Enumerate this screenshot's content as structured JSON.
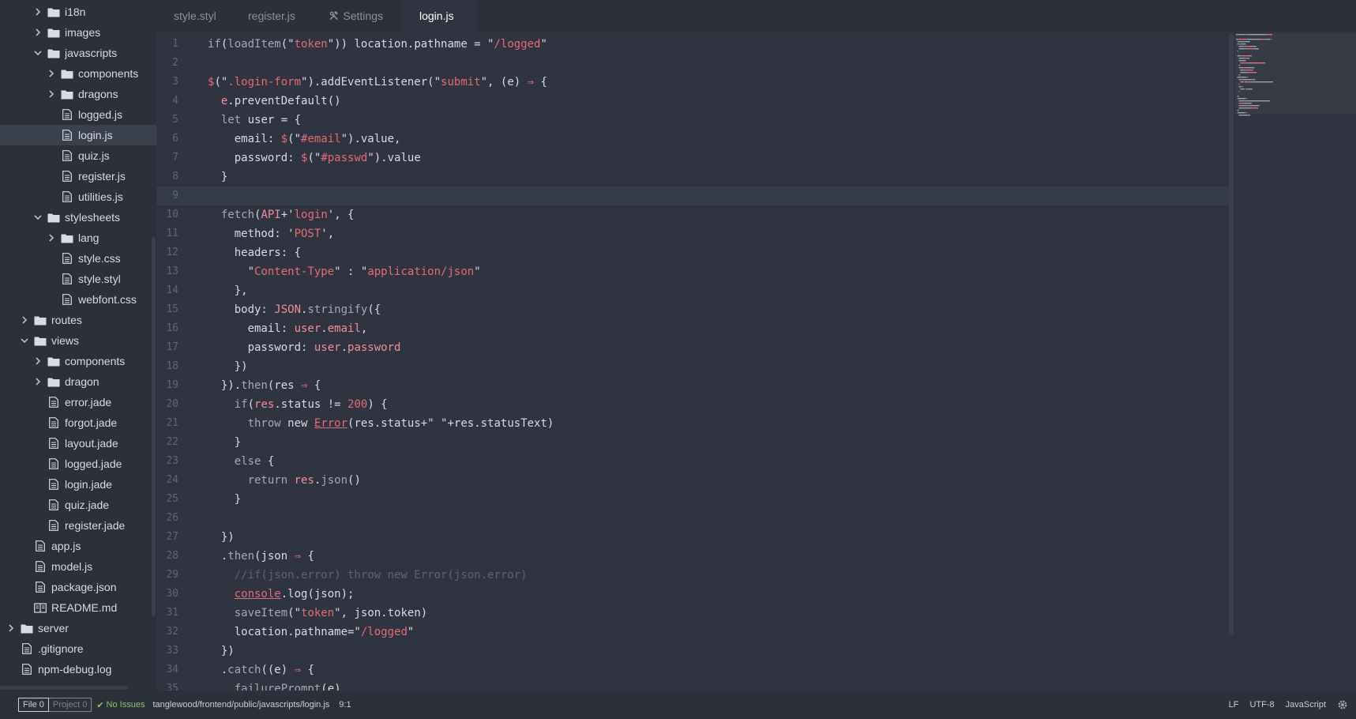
{
  "sidebar": {
    "items": [
      {
        "label": "i18n",
        "type": "folder",
        "collapsed": true,
        "depth": 3
      },
      {
        "label": "images",
        "type": "folder",
        "collapsed": true,
        "depth": 3
      },
      {
        "label": "javascripts",
        "type": "folder",
        "collapsed": false,
        "depth": 3
      },
      {
        "label": "components",
        "type": "folder",
        "collapsed": true,
        "depth": 4
      },
      {
        "label": "dragons",
        "type": "folder",
        "collapsed": true,
        "depth": 4
      },
      {
        "label": "logged.js",
        "type": "file",
        "depth": 4
      },
      {
        "label": "login.js",
        "type": "file",
        "depth": 4,
        "selected": true
      },
      {
        "label": "quiz.js",
        "type": "file",
        "depth": 4
      },
      {
        "label": "register.js",
        "type": "file",
        "depth": 4
      },
      {
        "label": "utilities.js",
        "type": "file",
        "depth": 4
      },
      {
        "label": "stylesheets",
        "type": "folder",
        "collapsed": false,
        "depth": 3
      },
      {
        "label": "lang",
        "type": "folder",
        "collapsed": true,
        "depth": 4
      },
      {
        "label": "style.css",
        "type": "file",
        "depth": 4
      },
      {
        "label": "style.styl",
        "type": "file",
        "depth": 4
      },
      {
        "label": "webfont.css",
        "type": "file",
        "depth": 4
      },
      {
        "label": "routes",
        "type": "folder",
        "collapsed": true,
        "depth": 2
      },
      {
        "label": "views",
        "type": "folder",
        "collapsed": false,
        "depth": 2
      },
      {
        "label": "components",
        "type": "folder",
        "collapsed": true,
        "depth": 3
      },
      {
        "label": "dragon",
        "type": "folder",
        "collapsed": true,
        "depth": 3
      },
      {
        "label": "error.jade",
        "type": "file",
        "depth": 3
      },
      {
        "label": "forgot.jade",
        "type": "file",
        "depth": 3
      },
      {
        "label": "layout.jade",
        "type": "file",
        "depth": 3
      },
      {
        "label": "logged.jade",
        "type": "file",
        "depth": 3
      },
      {
        "label": "login.jade",
        "type": "file",
        "depth": 3
      },
      {
        "label": "quiz.jade",
        "type": "file",
        "depth": 3
      },
      {
        "label": "register.jade",
        "type": "file",
        "depth": 3
      },
      {
        "label": "app.js",
        "type": "file",
        "depth": 2
      },
      {
        "label": "model.js",
        "type": "file",
        "depth": 2
      },
      {
        "label": "package.json",
        "type": "file",
        "depth": 2
      },
      {
        "label": "README.md",
        "type": "book",
        "depth": 2
      },
      {
        "label": "server",
        "type": "folder",
        "collapsed": true,
        "depth": 1
      },
      {
        "label": ".gitignore",
        "type": "file",
        "depth": 1
      },
      {
        "label": "npm-debug.log",
        "type": "file",
        "depth": 1
      }
    ]
  },
  "tabs": [
    {
      "label": "style.styl",
      "active": false,
      "icon": false
    },
    {
      "label": "register.js",
      "active": false,
      "icon": false
    },
    {
      "label": "Settings",
      "active": false,
      "icon": true
    },
    {
      "label": "login.js",
      "active": true,
      "icon": false
    }
  ],
  "editor": {
    "cursor_line": 9,
    "lines": [
      [
        [
          "kw",
          "if"
        ],
        [
          "p",
          "("
        ],
        [
          "fn",
          "loadItem"
        ],
        [
          "p",
          "(\""
        ],
        [
          "str",
          "token"
        ],
        [
          "p",
          "\")) location.pathname = \""
        ],
        [
          "str",
          "/logged"
        ],
        [
          "p",
          "\""
        ]
      ],
      [],
      [
        [
          "op",
          "$"
        ],
        [
          "p",
          "(\""
        ],
        [
          "str",
          ".login-form"
        ],
        [
          "p",
          "\").addEventListener(\""
        ],
        [
          "str",
          "submit"
        ],
        [
          "p",
          "\", (e) "
        ],
        [
          "op",
          "⇒"
        ],
        [
          "p",
          " {"
        ]
      ],
      [
        [
          "p",
          "  "
        ],
        [
          "id",
          "e"
        ],
        [
          "p",
          ".preventDefault()"
        ]
      ],
      [
        [
          "p",
          "  "
        ],
        [
          "kw",
          "let"
        ],
        [
          "p",
          " user = {"
        ]
      ],
      [
        [
          "p",
          "    email: "
        ],
        [
          "op",
          "$"
        ],
        [
          "p",
          "(\""
        ],
        [
          "str",
          "#email"
        ],
        [
          "p",
          "\").value,"
        ]
      ],
      [
        [
          "p",
          "    password: "
        ],
        [
          "op",
          "$"
        ],
        [
          "p",
          "(\""
        ],
        [
          "str",
          "#passwd"
        ],
        [
          "p",
          "\").value"
        ]
      ],
      [
        [
          "p",
          "  }"
        ]
      ],
      [],
      [
        [
          "p",
          "  "
        ],
        [
          "fn",
          "fetch"
        ],
        [
          "p",
          "("
        ],
        [
          "id",
          "API"
        ],
        [
          "p",
          "+'"
        ],
        [
          "str",
          "login"
        ],
        [
          "p",
          "', {"
        ]
      ],
      [
        [
          "p",
          "    method: '"
        ],
        [
          "str",
          "POST"
        ],
        [
          "p",
          "',"
        ]
      ],
      [
        [
          "p",
          "    headers: {"
        ]
      ],
      [
        [
          "p",
          "      \""
        ],
        [
          "str",
          "Content-Type"
        ],
        [
          "p",
          "\" : \""
        ],
        [
          "str",
          "application/json"
        ],
        [
          "p",
          "\""
        ]
      ],
      [
        [
          "p",
          "    },"
        ]
      ],
      [
        [
          "p",
          "    body: "
        ],
        [
          "id",
          "JSON"
        ],
        [
          "p",
          "."
        ],
        [
          "fn",
          "stringify"
        ],
        [
          "p",
          "({"
        ]
      ],
      [
        [
          "p",
          "      email: "
        ],
        [
          "id",
          "user"
        ],
        [
          "p",
          "."
        ],
        [
          "id",
          "email"
        ],
        [
          "p",
          ","
        ]
      ],
      [
        [
          "p",
          "      password: "
        ],
        [
          "id",
          "user"
        ],
        [
          "p",
          "."
        ],
        [
          "id",
          "password"
        ]
      ],
      [
        [
          "p",
          "    })"
        ]
      ],
      [
        [
          "p",
          "  })."
        ],
        [
          "fn",
          "then"
        ],
        [
          "p",
          "(res "
        ],
        [
          "op",
          "⇒"
        ],
        [
          "p",
          " {"
        ]
      ],
      [
        [
          "p",
          "    "
        ],
        [
          "kw",
          "if"
        ],
        [
          "p",
          "("
        ],
        [
          "id",
          "res"
        ],
        [
          "p",
          ".status != "
        ],
        [
          "num",
          "200"
        ],
        [
          "p",
          ") {"
        ]
      ],
      [
        [
          "p",
          "      "
        ],
        [
          "kw",
          "throw"
        ],
        [
          "p",
          " new "
        ],
        [
          "ul",
          "Error"
        ],
        [
          "p",
          "(res.status+\" \"+res.statusText)"
        ]
      ],
      [
        [
          "p",
          "    }"
        ]
      ],
      [
        [
          "p",
          "    "
        ],
        [
          "kw",
          "else"
        ],
        [
          "p",
          " {"
        ]
      ],
      [
        [
          "p",
          "      "
        ],
        [
          "kw",
          "return"
        ],
        [
          "p",
          " "
        ],
        [
          "id",
          "res"
        ],
        [
          "p",
          "."
        ],
        [
          "fn",
          "json"
        ],
        [
          "p",
          "()"
        ]
      ],
      [
        [
          "p",
          "    }"
        ]
      ],
      [],
      [
        [
          "p",
          "  })"
        ]
      ],
      [
        [
          "p",
          "  ."
        ],
        [
          "fn",
          "then"
        ],
        [
          "p",
          "(json "
        ],
        [
          "op",
          "⇒"
        ],
        [
          "p",
          " {"
        ]
      ],
      [
        [
          "p",
          "    "
        ],
        [
          "cm",
          "//if(json.error) throw new Error(json.error)"
        ]
      ],
      [
        [
          "p",
          "    "
        ],
        [
          "ul",
          "console"
        ],
        [
          "p",
          ".log(json);"
        ]
      ],
      [
        [
          "p",
          "    "
        ],
        [
          "fn",
          "saveItem"
        ],
        [
          "p",
          "(\""
        ],
        [
          "str",
          "token"
        ],
        [
          "p",
          "\", json.token)"
        ]
      ],
      [
        [
          "p",
          "    location.pathname=\""
        ],
        [
          "str",
          "/logged"
        ],
        [
          "p",
          "\""
        ]
      ],
      [
        [
          "p",
          "  })"
        ]
      ],
      [
        [
          "p",
          "  ."
        ],
        [
          "fn",
          "catch"
        ],
        [
          "p",
          "((e) "
        ],
        [
          "op",
          "⇒"
        ],
        [
          "p",
          " {"
        ]
      ],
      [
        [
          "p",
          "    "
        ],
        [
          "fn",
          "failurePrompt"
        ],
        [
          "p",
          "(e)"
        ]
      ]
    ]
  },
  "statusbar": {
    "file_label": "File 0",
    "project_label": "Project 0",
    "issues": "No Issues",
    "path": "tanglewood/frontend/public/javascripts/login.js",
    "cursor_pos": "9:1",
    "line_ending": "LF",
    "encoding": "UTF-8",
    "grammar": "JavaScript"
  },
  "colors": {
    "background": "#2f3440",
    "sidebar": "#2b3039",
    "string": "#e06c75",
    "keyword": "#a2a9b4",
    "ok": "#8cc265"
  }
}
